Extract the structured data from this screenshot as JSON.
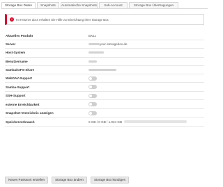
{
  "tabs": [
    {
      "label": "Storage Box Daten",
      "active": true
    },
    {
      "label": "Snapshots",
      "active": false
    },
    {
      "label": "Automatische Snapshots",
      "active": false
    },
    {
      "label": "Sub-Account",
      "active": false
    },
    {
      "label": "Storage Box Übertragungen",
      "active": false
    }
  ],
  "notice": {
    "icon": "info-icon",
    "text": "Im Hetzner docs erhalten Sie Hilfe zur Einrichtung Ihrer Storage Box"
  },
  "fields": {
    "product": {
      "label": "Aktuelles Produkt",
      "value": "BX11"
    },
    "server": {
      "label": "Server",
      "value": "your-storagebox.de"
    },
    "host_system": {
      "label": "Host-System"
    },
    "username": {
      "label": "Benutzername"
    },
    "samba_share": {
      "label": "Samba/CIFS-Share"
    },
    "webdav": {
      "label": "WebDAV-Support",
      "enabled": false
    },
    "samba": {
      "label": "Samba-Support",
      "enabled": false
    },
    "ssh": {
      "label": "SSH-Support",
      "enabled": false
    },
    "external": {
      "label": "externe Erreichbarkeit",
      "enabled": false
    },
    "snapshot_dir": {
      "label": "Snapshot-Verzeichnis anzeigen",
      "enabled": false
    },
    "usage": {
      "label": "Speicherverbrauch",
      "value": "0 GB / 0 GB / 1.024 GB",
      "fraction": 0
    }
  },
  "buttons": {
    "new_password": "Neues Passwort erstellen",
    "change_box": "Storage Box ändern",
    "cancel_box": "Storage Box kündigen"
  },
  "colors": {
    "accent": "#d50c2d"
  }
}
